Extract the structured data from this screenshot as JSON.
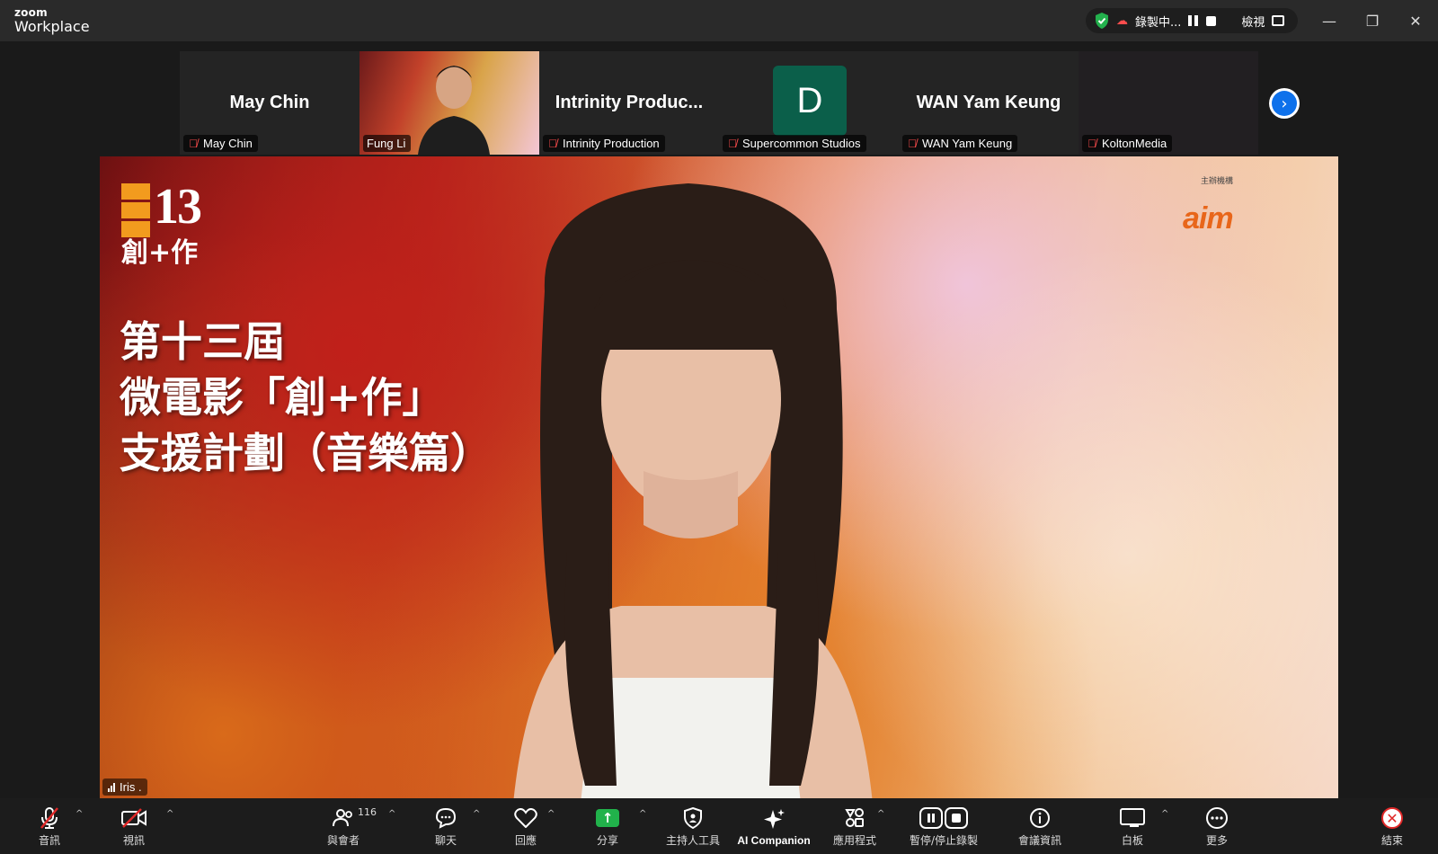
{
  "app": {
    "brand_top": "zoom",
    "brand_bottom": "Workplace"
  },
  "recording": {
    "status": "錄製中...",
    "view_label": "檢視"
  },
  "participants": [
    {
      "display": "May Chin",
      "name": "May Chin"
    },
    {
      "display": "",
      "name": "Fung Li"
    },
    {
      "display": "Intrinity Produc...",
      "name": "Intrinity Production"
    },
    {
      "display": "D",
      "name": "Supercommon Studios"
    },
    {
      "display": "WAN Yam Keung",
      "name": "WAN Yam Keung"
    },
    {
      "display": "",
      "name": "KoltonMedia"
    }
  ],
  "main": {
    "slide_logo_number": "13",
    "slide_logo_text": "創+作",
    "slide_title_lines": [
      "第十三屆",
      "微電影「創+作」",
      "支援計劃（音樂篇）"
    ],
    "aim_small_text": "主辦機構",
    "aim_logo": "aim",
    "speaker_name": "Iris ."
  },
  "toolbar": {
    "audio": "音訊",
    "video": "視訊",
    "participants": "與會者",
    "participants_count": "116",
    "chat": "聊天",
    "react": "回應",
    "share": "分享",
    "host_tools": "主持人工具",
    "ai_companion": "AI Companion",
    "apps": "應用程式",
    "record": "暫停/停止錄製",
    "meeting_info": "會議資訊",
    "whiteboard": "白板",
    "more": "更多",
    "end": "結束"
  },
  "colors": {
    "accent_blue": "#0e71eb",
    "share_green": "#21b24b",
    "end_red": "#e02828",
    "avatar_green": "#0b5f4a"
  }
}
